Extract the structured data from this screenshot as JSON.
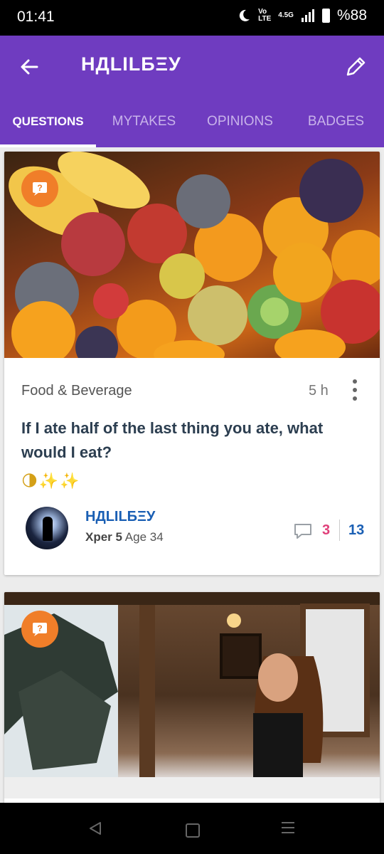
{
  "status": {
    "time": "01:41",
    "network_top": "Vo",
    "network_bottom": "LTE",
    "net_speed": "4.5G",
    "battery": "%88"
  },
  "header": {
    "title": "НДLILБΞУ"
  },
  "tabs": [
    {
      "label": "QUESTIONS"
    },
    {
      "label": "MYTAKES"
    },
    {
      "label": "OPINIONS"
    },
    {
      "label": "BADGES"
    }
  ],
  "posts": [
    {
      "category": "Food & Beverage",
      "time": "5 h",
      "title": "If I ate half of the last thing you ate, what would I eat?",
      "emoji": "🌗✨✨",
      "author": {
        "name": "НДLILБΞУ",
        "level": "Xper 5",
        "age": "Age 34"
      },
      "comments": "3",
      "votes": "13",
      "image_icon": "fruit-photo"
    },
    {
      "image_icon": "winter-cabin-photo"
    }
  ],
  "colors": {
    "accent": "#6f3cc0",
    "badge": "#f07e29",
    "author": "#1a5fb4",
    "comments": "#e0407a"
  }
}
